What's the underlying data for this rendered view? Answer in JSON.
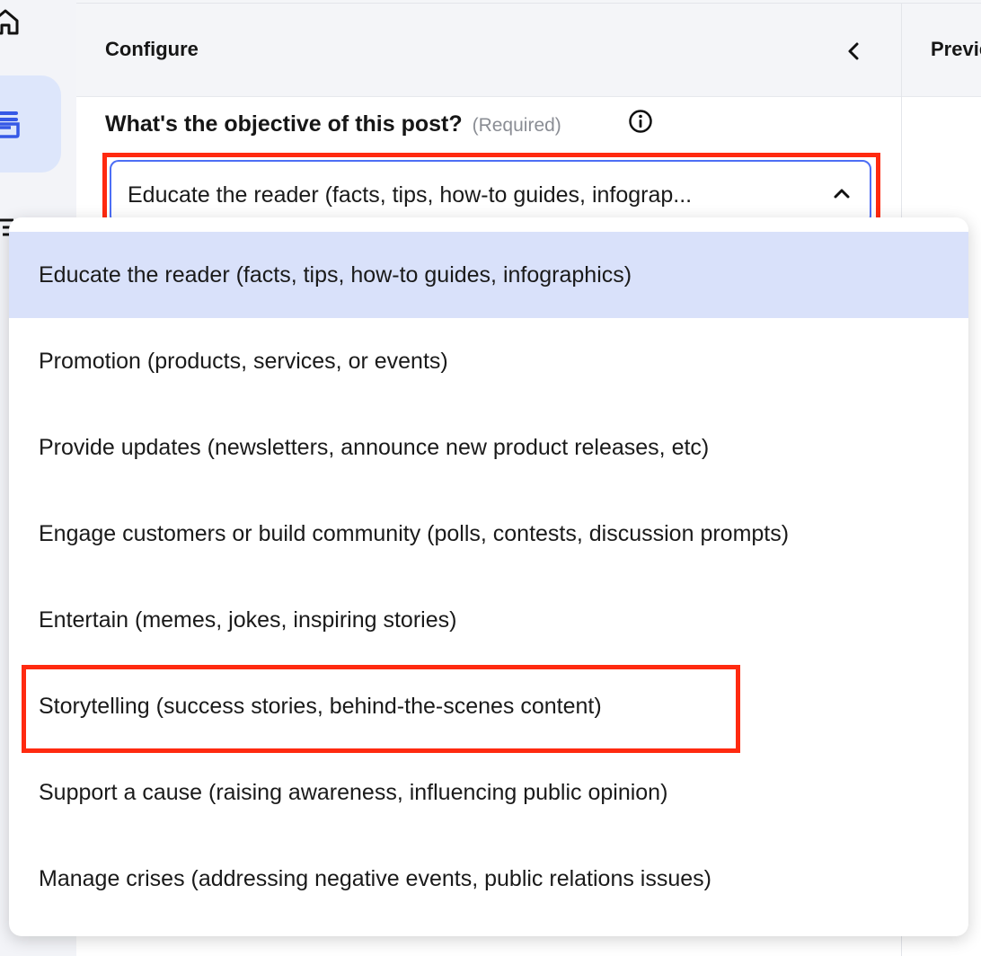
{
  "panel": {
    "title": "Configure",
    "preview_title": "Preview"
  },
  "field": {
    "label": "What's the objective of this post?",
    "required": "(Required)",
    "selected_value": "Educate the reader (facts, tips, how-to guides, infograp..."
  },
  "dropdown": {
    "options": [
      "Educate the reader (facts, tips, how-to guides, infographics)",
      "Promotion (products, services, or events)",
      "Provide updates (newsletters, announce new product releases, etc)",
      "Engage customers or build community (polls, contests, discussion prompts)",
      "Entertain (memes, jokes, inspiring stories)",
      "Storytelling (success stories, behind-the-scenes content)",
      "Support a cause (raising awareness, influencing public opinion)",
      "Manage crises (addressing negative events, public relations issues)"
    ]
  },
  "colors": {
    "accent": "#4d6ef5",
    "selected_bg": "#d9e1fa",
    "highlight": "#ff2a10"
  },
  "icons": [
    "home-icon",
    "inbox-icon",
    "list-icon",
    "chevron-left-icon",
    "info-icon",
    "chevron-up-icon"
  ]
}
